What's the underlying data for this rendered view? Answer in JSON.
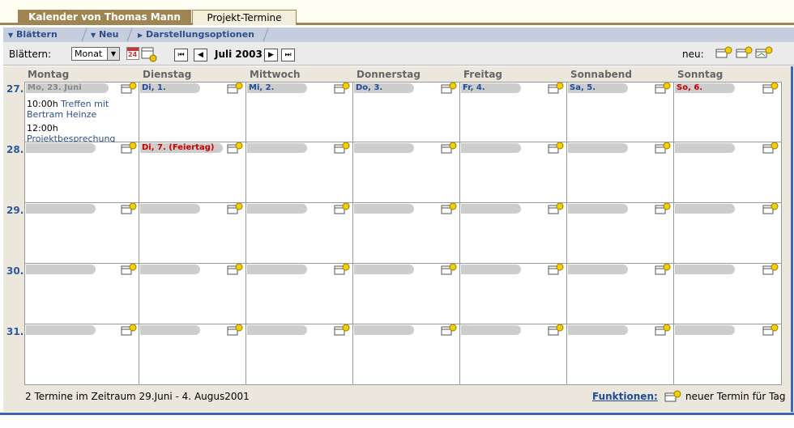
{
  "tabs": {
    "active": "Kalender von Thomas Mann",
    "inactive": "Projekt-Termine"
  },
  "toolbar": {
    "browse": "Blättern",
    "new": "Neu",
    "display": "Darstellungsoptionen"
  },
  "browse_bar": {
    "label": "Blättern:",
    "view_select": "Monat",
    "calendar_icon_text": "24",
    "period": "Juli 2003",
    "new_label": "neu:"
  },
  "days": [
    "Montag",
    "Dienstag",
    "Mittwoch",
    "Donnerstag",
    "Freitag",
    "Sonnabend",
    "Sonntag"
  ],
  "weeks": [
    {
      "number": "27.",
      "cells": [
        {
          "label": "Mo, 23. Juni",
          "color": "#888888"
        },
        {
          "label": "Di, 1.",
          "color": "#1f4b99"
        },
        {
          "label": "Mi, 2.",
          "color": "#1f4b99"
        },
        {
          "label": "Do, 3.",
          "color": "#1f4b99"
        },
        {
          "label": "Fr, 4.",
          "color": "#1f4b99"
        },
        {
          "label": "Sa, 5.",
          "color": "#1f4b99"
        },
        {
          "label": "So, 6.",
          "color": "#cc0000"
        }
      ]
    },
    {
      "number": "28.",
      "cells": [
        {
          "label": "",
          "color": "#1f4b99"
        },
        {
          "label": "Di, 7. (Feiertag)",
          "color": "#cc0000"
        },
        {
          "label": "",
          "color": "#1f4b99"
        },
        {
          "label": "",
          "color": "#1f4b99"
        },
        {
          "label": "",
          "color": "#1f4b99"
        },
        {
          "label": "",
          "color": "#1f4b99"
        },
        {
          "label": "",
          "color": "#1f4b99"
        }
      ]
    },
    {
      "number": "29.",
      "cells": [
        {
          "label": ""
        },
        {
          "label": ""
        },
        {
          "label": ""
        },
        {
          "label": ""
        },
        {
          "label": ""
        },
        {
          "label": ""
        },
        {
          "label": ""
        }
      ]
    },
    {
      "number": "30.",
      "cells": [
        {
          "label": ""
        },
        {
          "label": ""
        },
        {
          "label": ""
        },
        {
          "label": ""
        },
        {
          "label": ""
        },
        {
          "label": ""
        },
        {
          "label": ""
        }
      ]
    },
    {
      "number": "31.",
      "cells": [
        {
          "label": ""
        },
        {
          "label": ""
        },
        {
          "label": ""
        },
        {
          "label": ""
        },
        {
          "label": ""
        },
        {
          "label": ""
        },
        {
          "label": ""
        }
      ]
    }
  ],
  "events": [
    {
      "time": "10:00h",
      "title": "Treffen mit Bertram Heinze"
    },
    {
      "time": "12:00h",
      "title": "Projektbesprechung"
    }
  ],
  "footer": {
    "summary": "2 Termine im Zeitraum 29.Juni - 4. Augus2001",
    "functions": "Funktionen:",
    "new_entry": "neuer Termin für Tag"
  },
  "colors": {
    "tab_active": "#9e8552",
    "toolbar": "#c6cedd",
    "accent_blue": "#3a66b5",
    "holiday": "#cc0000"
  }
}
